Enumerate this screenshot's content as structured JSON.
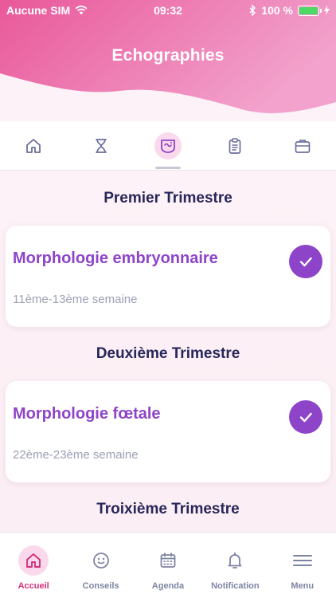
{
  "status_bar": {
    "carrier": "Aucune SIM",
    "time": "09:32",
    "battery": "100 %",
    "battery_level": 1.0
  },
  "header": {
    "title": "Echographies"
  },
  "tabs": [
    {
      "icon": "home-icon",
      "active": false
    },
    {
      "icon": "hourglass-icon",
      "active": false
    },
    {
      "icon": "ultrasound-icon",
      "active": true
    },
    {
      "icon": "clipboard-icon",
      "active": false
    },
    {
      "icon": "briefcase-icon",
      "active": false
    }
  ],
  "sections": [
    {
      "title": "Premier Trimestre",
      "card": {
        "title": "Morphologie embryonnaire",
        "subtitle": "11ème-13ème semaine",
        "done": true
      }
    },
    {
      "title": "Deuxième Trimestre",
      "card": {
        "title": "Morphologie fœtale",
        "subtitle": "22ème-23ème semaine",
        "done": true
      }
    },
    {
      "title": "Troixième Trimestre"
    }
  ],
  "bottom_nav": [
    {
      "label": "Accueil",
      "icon": "home-icon",
      "active": true
    },
    {
      "label": "Conseils",
      "icon": "smiley-icon",
      "active": false
    },
    {
      "label": "Agenda",
      "icon": "calendar-icon",
      "active": false
    },
    {
      "label": "Notification",
      "icon": "bell-icon",
      "active": false
    },
    {
      "label": "Menu",
      "icon": "menu-icon",
      "active": false
    }
  ],
  "colors": {
    "accent": "#8e44c9",
    "header_pink": "#ec6aa8",
    "active_nav": "#d6317a"
  }
}
